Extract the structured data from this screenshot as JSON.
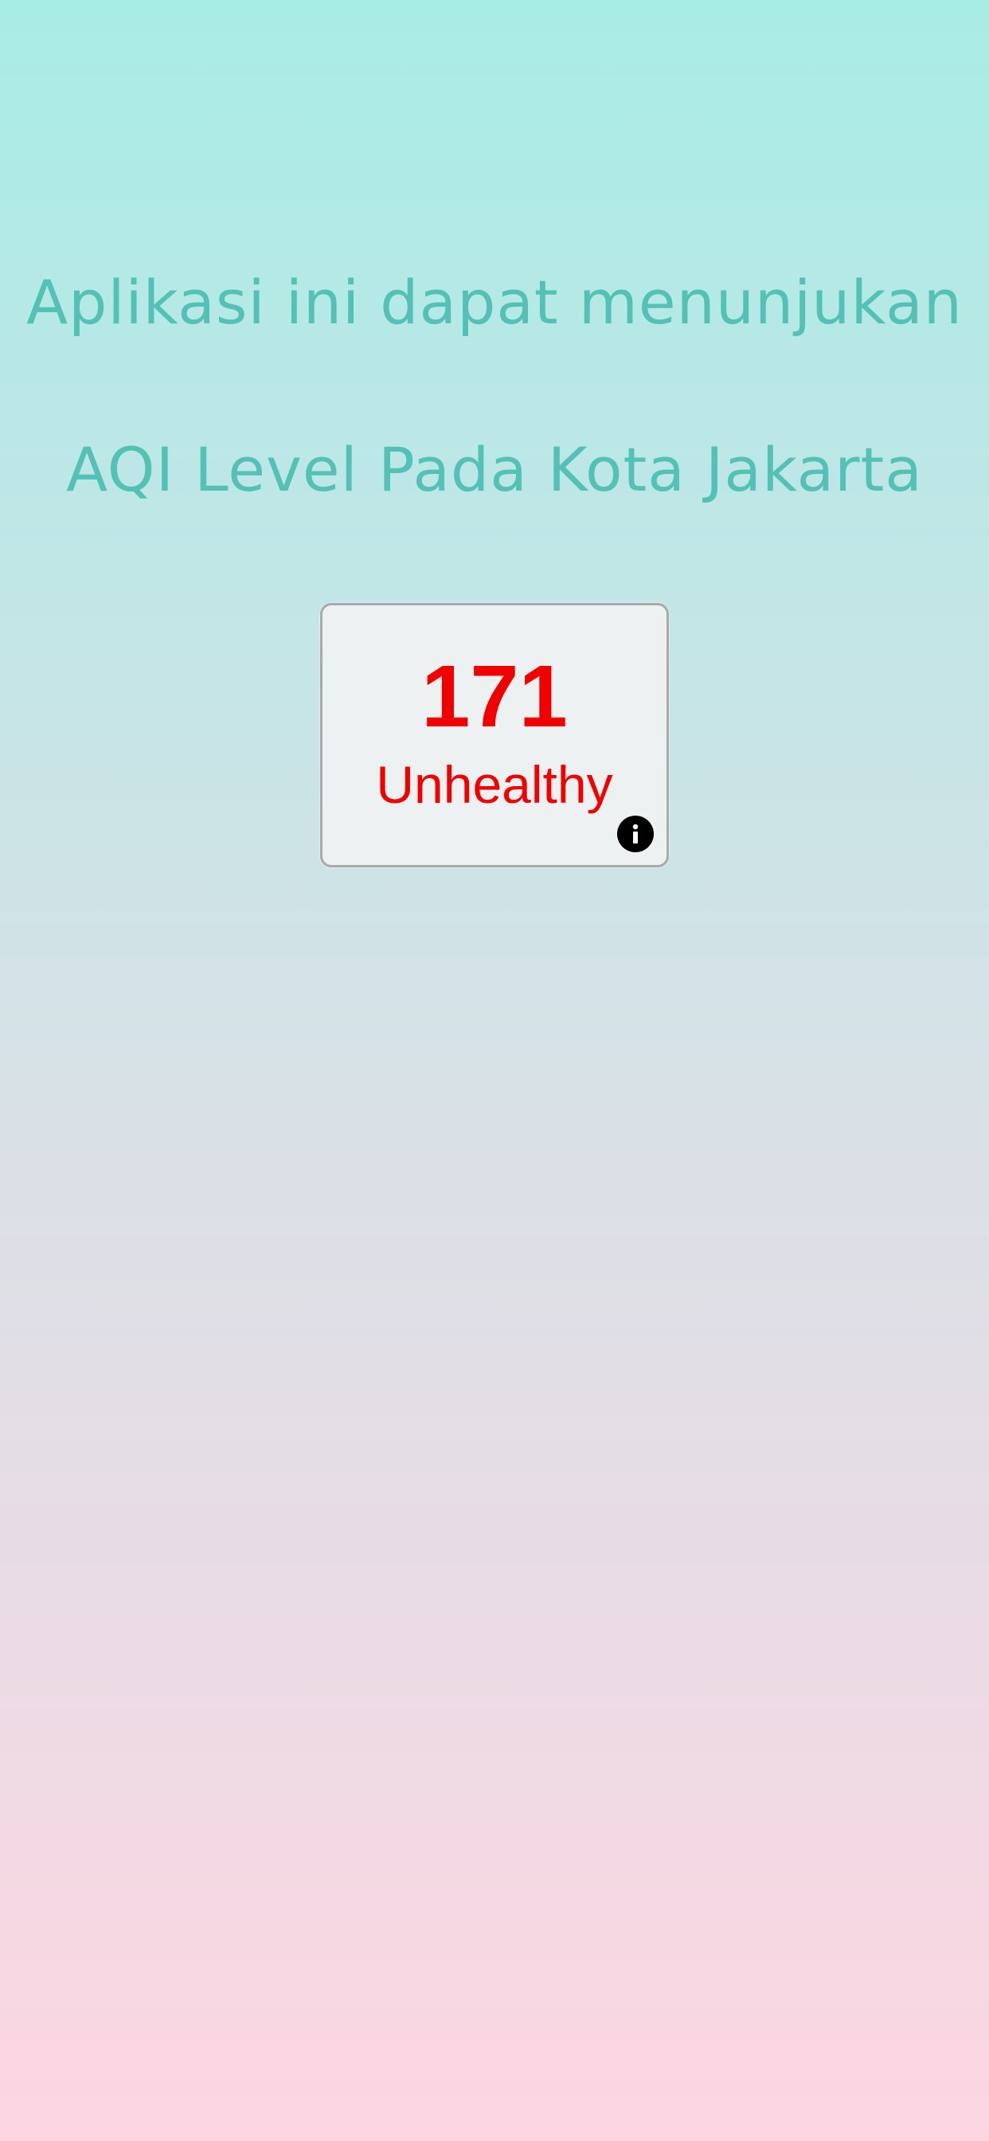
{
  "headline": {
    "line1": "Aplikasi ini dapat menunjukan",
    "line2": "AQI Level Pada Kota Jakarta"
  },
  "aqi_card": {
    "value": "171",
    "status": "Unhealthy",
    "status_color": "#f20000",
    "info_icon": "info-icon"
  },
  "colors": {
    "headline": "#53c1b5",
    "gradient_top": "#a8ece6",
    "gradient_bottom": "#fdd6e2"
  }
}
